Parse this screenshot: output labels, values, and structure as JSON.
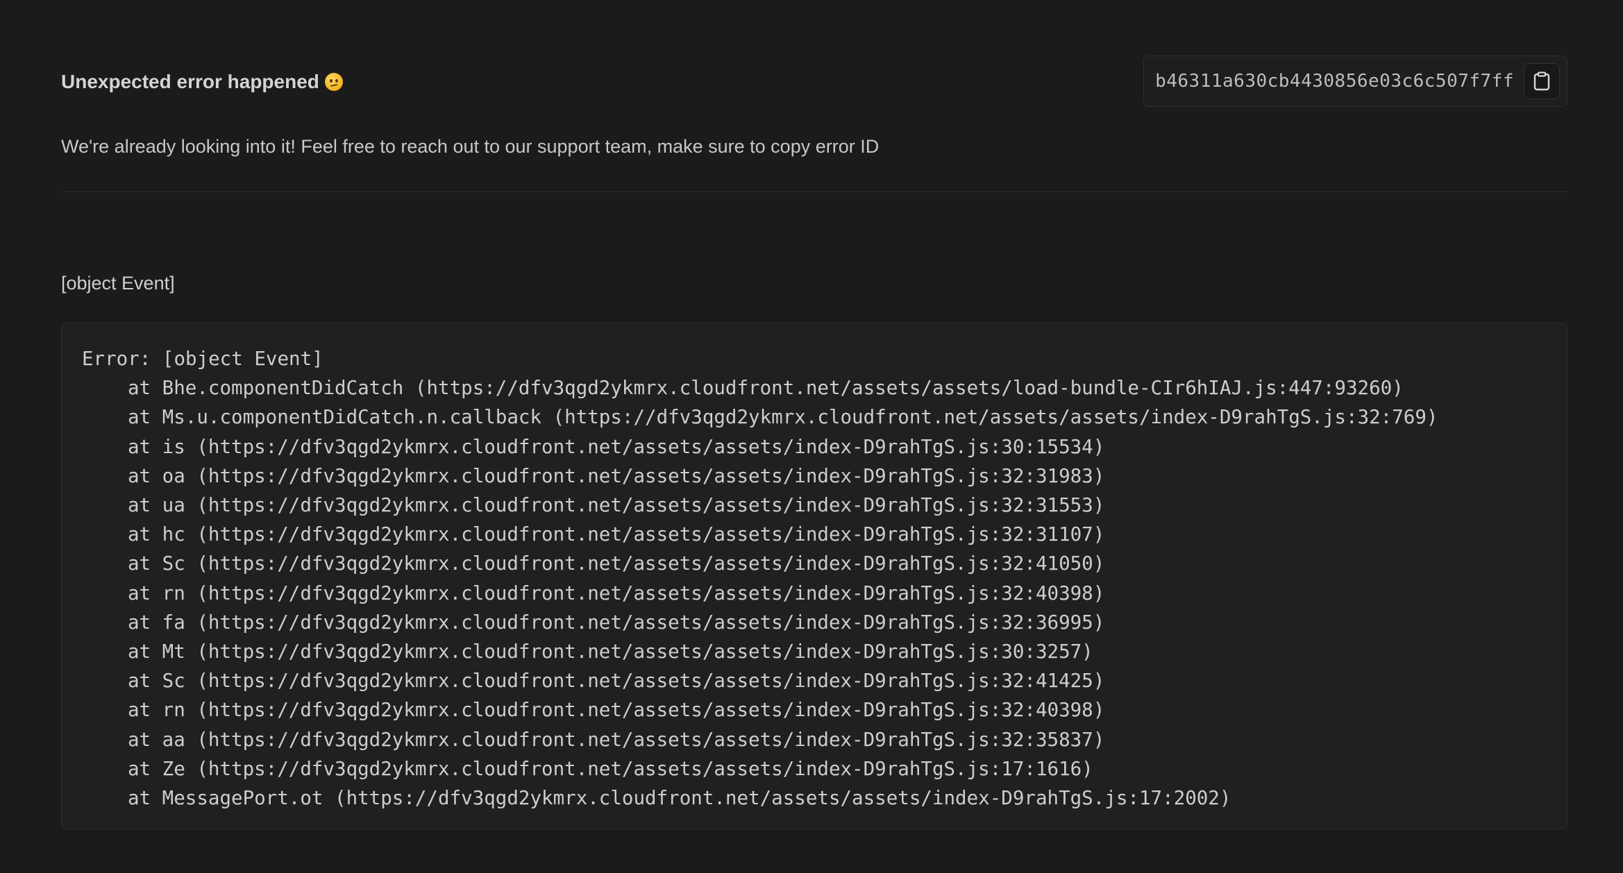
{
  "header": {
    "title": "Unexpected error happened",
    "emoji_icon": "confused-face-icon",
    "error_id": "b46311a630cb4430856e03c6c507f7ff",
    "copy_icon": "clipboard-icon"
  },
  "subtitle": "We're already looking into it! Feel free to reach out to our support team, make sure to copy error ID",
  "message": "[object Event]",
  "stack": {
    "first_line": "Error: [object Event]",
    "frames": [
      "at Bhe.componentDidCatch (https://dfv3qgd2ykmrx.cloudfront.net/assets/assets/load-bundle-CIr6hIAJ.js:447:93260)",
      "at Ms.u.componentDidCatch.n.callback (https://dfv3qgd2ykmrx.cloudfront.net/assets/assets/index-D9rahTgS.js:32:769)",
      "at is (https://dfv3qgd2ykmrx.cloudfront.net/assets/assets/index-D9rahTgS.js:30:15534)",
      "at oa (https://dfv3qgd2ykmrx.cloudfront.net/assets/assets/index-D9rahTgS.js:32:31983)",
      "at ua (https://dfv3qgd2ykmrx.cloudfront.net/assets/assets/index-D9rahTgS.js:32:31553)",
      "at hc (https://dfv3qgd2ykmrx.cloudfront.net/assets/assets/index-D9rahTgS.js:32:31107)",
      "at Sc (https://dfv3qgd2ykmrx.cloudfront.net/assets/assets/index-D9rahTgS.js:32:41050)",
      "at rn (https://dfv3qgd2ykmrx.cloudfront.net/assets/assets/index-D9rahTgS.js:32:40398)",
      "at fa (https://dfv3qgd2ykmrx.cloudfront.net/assets/assets/index-D9rahTgS.js:32:36995)",
      "at Mt (https://dfv3qgd2ykmrx.cloudfront.net/assets/assets/index-D9rahTgS.js:30:3257)",
      "at Sc (https://dfv3qgd2ykmrx.cloudfront.net/assets/assets/index-D9rahTgS.js:32:41425)",
      "at rn (https://dfv3qgd2ykmrx.cloudfront.net/assets/assets/index-D9rahTgS.js:32:40398)",
      "at aa (https://dfv3qgd2ykmrx.cloudfront.net/assets/assets/index-D9rahTgS.js:32:35837)",
      "at Ze (https://dfv3qgd2ykmrx.cloudfront.net/assets/assets/index-D9rahTgS.js:17:1616)",
      "at MessagePort.ot (https://dfv3qgd2ykmrx.cloudfront.net/assets/assets/index-D9rahTgS.js:17:2002)"
    ]
  },
  "colors": {
    "background": "#1b1b1b",
    "panel": "#202020",
    "border": "#2c2c2c",
    "text": "#cdcdcd"
  }
}
